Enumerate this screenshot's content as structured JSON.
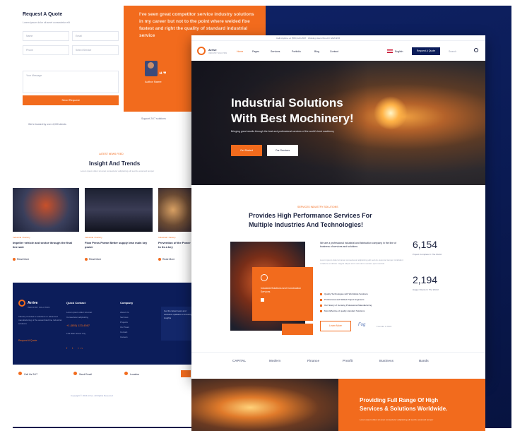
{
  "left": {
    "quote_text": "I've seen great competitor service industry solutions in my career but not to the point where welded fixe fastest and right the quality of standard industrial service",
    "quote_author": "Author Name",
    "form": {
      "title": "Request A Quote",
      "subtitle": "Lorem ipsum dolor sit amet consectetur elit",
      "field_name": "Name",
      "field_email": "Email",
      "field_phone": "Phone",
      "field_service": "Select Service",
      "field_message": "Your Message",
      "submit": "Send Request"
    },
    "trust_text": "We're trusted by over 4,000 clients",
    "trust_right": "Support 24/7 solutions",
    "insights": {
      "kicker": "LATEST NEWS FEED",
      "title": "Insight And Trends",
      "subtitle": "Lorem ipsum dolor sit amet consectetur adipisicing elit sed do eiusmod tempor",
      "cards": [
        {
          "meta": "Industrial / Factory",
          "title": "Impeller vehicle and sector through the final line sale",
          "more": "Read More"
        },
        {
          "meta": "Industrial / Factory",
          "title": "Flow Press Frame Better supply lean main key power",
          "more": "Read More"
        },
        {
          "meta": "Industrial / Factory",
          "title": "Prevention of the Power to its a key",
          "more": "Read More"
        }
      ]
    },
    "footer": {
      "brand": "Arrive",
      "tag": "INDUSTRY SOLUTION",
      "desc": "Industry founded a workforce in advanced manufacturing of the assembled line Industrial solutions",
      "link": "Request A Quote",
      "col1_h": "Quick Contact",
      "col1_items": [
        "Lorem ipsum dolor sit amet",
        "Consectetur adipisicing",
        "+1 (555) 123-4567",
        "123 Main Street City"
      ],
      "col2_h": "Company",
      "col2_items": [
        "About Us",
        "Services",
        "Projects",
        "Our Team",
        "Contact",
        "Careers"
      ],
      "news_text": "Get the latest news and exclusive updates on industry insights",
      "social": "f t in"
    },
    "footbar": [
      "Call Us 24/7",
      "Send Email",
      "Location"
    ],
    "copyright": "Copyright © 2024 Arrive. All Rights Reserved"
  },
  "main": {
    "topbar": "Call Anytime +1 (555) 123-4567 · Working Hours Mon-Fri 9AM-6PM",
    "nav": {
      "brand": "Arrive",
      "tag": "INDUSTRY SOLUTION",
      "items": [
        "Home",
        "Pages",
        "Services",
        "Portfolio",
        "Blog",
        "Contact"
      ],
      "lang": "English",
      "quote_btn": "Request A Quote",
      "search": "Search"
    },
    "hero": {
      "title_1": "Industrial Solutions",
      "title_2": "With Best Mochinery!",
      "subtitle": "Bringing great results through the best and professional services of the world's best machinery",
      "btn_primary": "Get Started",
      "btn_secondary": "Our Services"
    },
    "services": {
      "kicker": "SERVICES INDUSTRY SOLUTIONS",
      "title_1": "Provides High Performance Services For",
      "title_2": "Multiple Industries And Technologies!",
      "box_text": "Industrial Solutions And Construction Services",
      "desc_1": "We are a professional industrial and fabrication company in the line of business of services and solutions",
      "desc_2": "Lorem ipsum dolor sit amet consectetur adipisicing elit sed do eiusmod tempor incididunt ut labore et dolore magna aliqua enim ad minim veniam quis nostrud",
      "list": [
        "Quality Technologies with Worldwide Solutions",
        "Professional and Skilled Project Engineers",
        "Our history of focusing Professional Manufacturing",
        "Most Effective of quality standard Solutions"
      ],
      "btn": "Learn More",
      "sig": "Fog",
      "sig_name": "Founder & CEO",
      "stat_1_value": "6,154",
      "stat_1_label": "Project Complete In The World",
      "stat_2_value": "2,194",
      "stat_2_label": "Happy Clients In The World"
    },
    "partners": [
      "CAPITAL",
      "Modern",
      "Finance",
      "Proofit",
      "Business",
      "Bands"
    ],
    "bottom": {
      "title_1": "Providing Full Range Of High",
      "title_2": "Services & Solutions Worldwide.",
      "subtitle": "Lorem ipsum dolor sit amet consectetur adipisicing elit sed do eiusmod tempor"
    }
  },
  "colors": {
    "accent": "#f26b1d",
    "navy": "#0c1d5a",
    "text": "#1c2340"
  }
}
